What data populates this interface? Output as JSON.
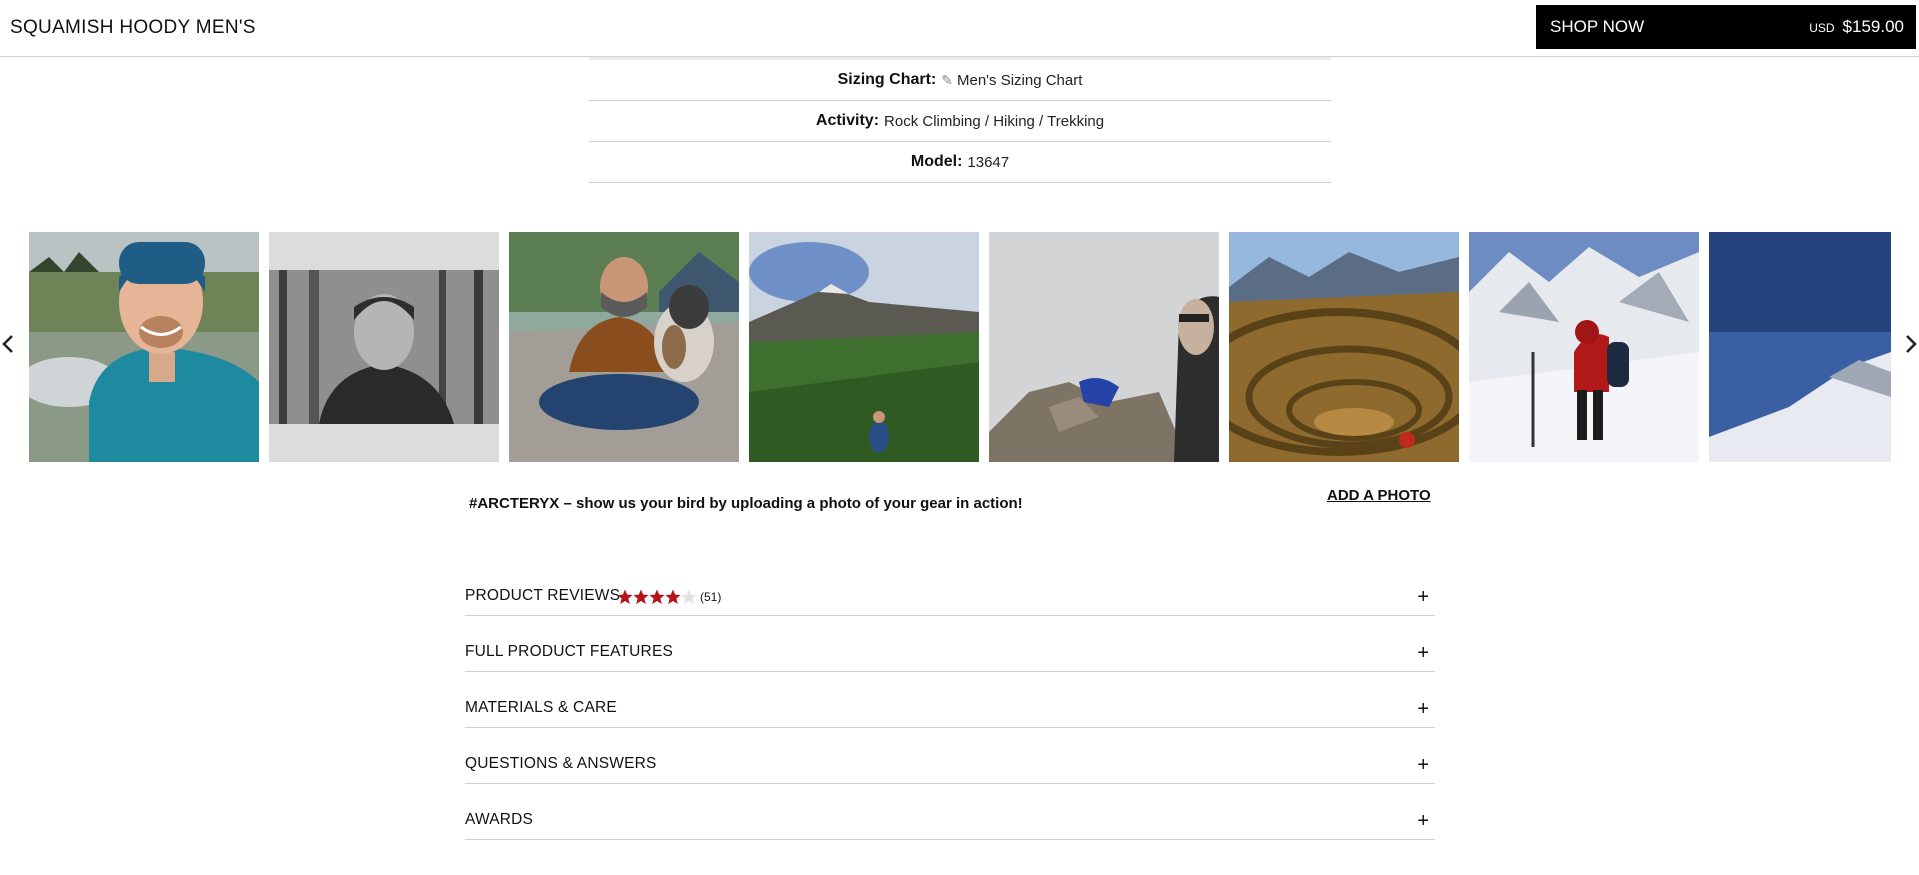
{
  "header": {
    "product_name": "SQUAMISH HOODY MEN'S",
    "shop_now": "SHOP NOW",
    "currency": "USD",
    "price": "$159.00"
  },
  "specs": {
    "sizing_label": "Sizing Chart:",
    "sizing_value": "Men's Sizing Chart",
    "activity_label": "Activity:",
    "activity_value": "Rock Climbing / Hiking / Trekking",
    "model_label": "Model:",
    "model_value": "13647"
  },
  "carousel": {
    "photos": [
      {
        "name": "photo-smiling-man-blue-jacket"
      },
      {
        "name": "photo-man-black-and-white"
      },
      {
        "name": "photo-man-with-dog"
      },
      {
        "name": "photo-green-mountain-slope"
      },
      {
        "name": "photo-rocky-summit-selfie"
      },
      {
        "name": "photo-andean-terraces"
      },
      {
        "name": "photo-climber-red-jacket-snow"
      },
      {
        "name": "photo-snowy-ridge-blue-sky"
      }
    ]
  },
  "ugc": {
    "caption": "#ARCTERYX – show us your bird by uploading a photo of your gear in action!",
    "add_photo": "ADD A PHOTO"
  },
  "accordions": {
    "reviews_label": "PRODUCT REVIEWS",
    "rating": 4.5,
    "review_count": "(51)",
    "features_label": "FULL PRODUCT FEATURES",
    "materials_label": "MATERIALS & CARE",
    "qa_label": "QUESTIONS & ANSWERS",
    "awards_label": "AWARDS",
    "expand_symbol": "+"
  },
  "colors": {
    "accent_black": "#000000",
    "star_red": "#b3151b",
    "divider": "#cfcfcf"
  }
}
